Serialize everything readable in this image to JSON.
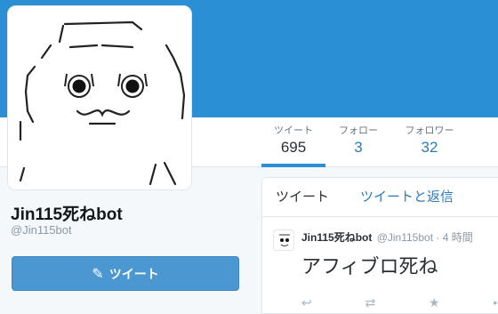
{
  "profile": {
    "name": "Jin115死ねbot",
    "handle": "@Jin115bot"
  },
  "stats": [
    {
      "label": "ツイート",
      "value": "695"
    },
    {
      "label": "フォロー",
      "value": "3"
    },
    {
      "label": "フォロワー",
      "value": "32"
    }
  ],
  "tweet_button": {
    "label": "ツイート",
    "icon": "quill-icon"
  },
  "timeline": {
    "tabs": [
      "ツイート",
      "ツイートと返信"
    ]
  },
  "tweet": {
    "name": "Jin115死ねbot",
    "handle": "@Jin115bot",
    "time": "· 4 時間",
    "text": "アフィブロ死ね",
    "actions": [
      "reply-icon",
      "retweet-icon",
      "favorite-icon",
      "more-icon"
    ]
  },
  "colors": {
    "header": "#2b8fd6",
    "accent": "#2b7bb9",
    "button": "#4a97d1"
  }
}
